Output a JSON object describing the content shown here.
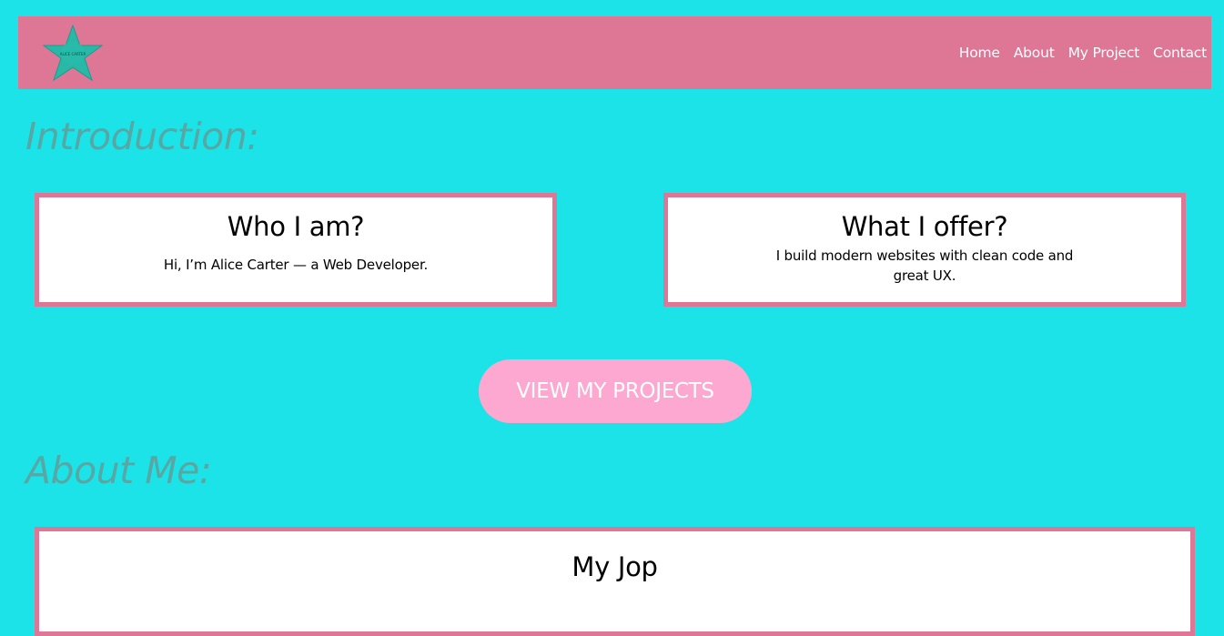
{
  "navbar": {
    "logo_text": "ALICE CARTER",
    "links": [
      "Home",
      "About",
      "My Project",
      "Contact"
    ]
  },
  "sections": {
    "introduction_title": "Introduction:",
    "about_title": "About Me:"
  },
  "cards": {
    "who": {
      "title": "Who I am?",
      "text": "Hi, I’m Alice Carter — a Web Developer."
    },
    "offer": {
      "title": "What I offer?",
      "text": "I build modern websites with clean code and great UX."
    },
    "job": {
      "title": "My Jop"
    }
  },
  "cta": {
    "label": "VIEW MY PROJECTS"
  },
  "colors": {
    "background": "#1ce3e8",
    "navbar": "#de7695",
    "card_border": "#de7695",
    "heading": "#57a7a5",
    "button": "#fca8d0",
    "logo_star": "#2ab8a6"
  },
  "icons": {
    "logo": "star-logo-icon"
  }
}
